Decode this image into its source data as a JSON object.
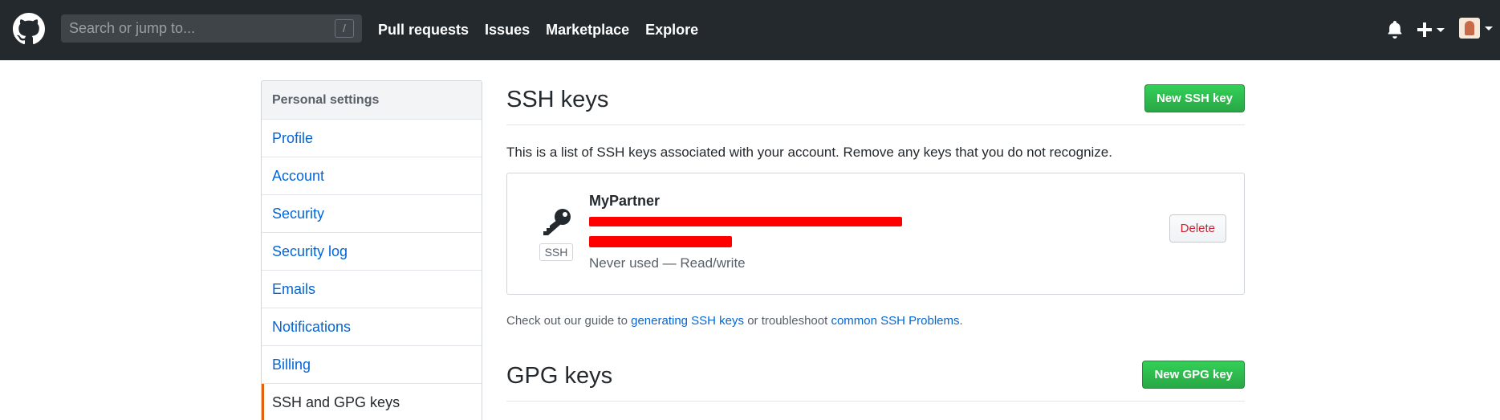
{
  "header": {
    "search_placeholder": "Search or jump to...",
    "slash_key": "/",
    "nav": [
      "Pull requests",
      "Issues",
      "Marketplace",
      "Explore"
    ]
  },
  "sidebar": {
    "heading": "Personal settings",
    "items": [
      {
        "label": "Profile"
      },
      {
        "label": "Account"
      },
      {
        "label": "Security"
      },
      {
        "label": "Security log"
      },
      {
        "label": "Emails"
      },
      {
        "label": "Notifications"
      },
      {
        "label": "Billing"
      },
      {
        "label": "SSH and GPG keys",
        "selected": true
      }
    ]
  },
  "ssh": {
    "title": "SSH keys",
    "new_button": "New SSH key",
    "description": "This is a list of SSH keys associated with your account. Remove any keys that you do not recognize.",
    "key": {
      "name": "MyPartner",
      "badge": "SSH",
      "usage": "Never used — Read/write",
      "delete_label": "Delete"
    },
    "guide": {
      "prefix": "Check out our guide to ",
      "link1": "generating SSH keys",
      "middle": " or troubleshoot ",
      "link2": "common SSH Problems",
      "suffix": "."
    }
  },
  "gpg": {
    "title": "GPG keys",
    "new_button": "New GPG key"
  },
  "colors": {
    "header_bg": "#24292e",
    "link": "#0366d6",
    "green_button": "#28a745",
    "danger": "#cb2431",
    "selected_accent": "#e36209",
    "redaction": "#ff0000"
  },
  "icons": [
    "github-logo-icon",
    "bell-icon",
    "plus-icon",
    "chevron-down-icon",
    "key-icon"
  ]
}
